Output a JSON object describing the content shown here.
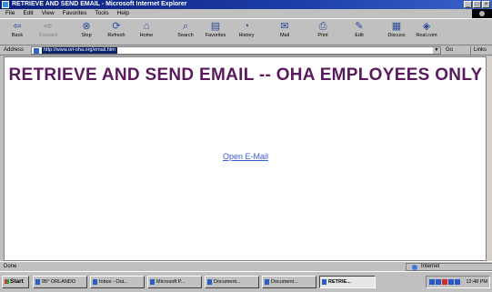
{
  "window": {
    "title": "RETRIEVE AND SEND EMAIL - Microsoft Internet Explorer",
    "controls": [
      "_",
      "□",
      "×"
    ]
  },
  "menu": [
    "File",
    "Edit",
    "View",
    "Favorites",
    "Tools",
    "Help"
  ],
  "toolbar": {
    "back": "Back",
    "forward": "Forward",
    "stop": "Stop",
    "refresh": "Refresh",
    "home": "Home",
    "search": "Search",
    "favorites": "Favorites",
    "history": "History",
    "mail": "Mail",
    "print": "Print",
    "edit": "Edit",
    "discuss": "Discuss",
    "realcom": "Real.com"
  },
  "address": {
    "label": "Address",
    "url": "http://www.orl-oha.org/email.htm",
    "go": "Go",
    "links": "Links"
  },
  "page": {
    "heading": "RETRIEVE AND SEND EMAIL -- OHA EMPLOYEES ONLY",
    "link": "Open E-Mail",
    "heading_color": "#5a1a5e",
    "link_color": "#3b5bd6"
  },
  "status": {
    "text": "Done",
    "zone": "Internet"
  },
  "taskbar": {
    "start": "Start",
    "tasks": [
      "95° ORLANDO",
      "Inbox - Out...",
      "Microsoft P...",
      "Document...",
      "Document...",
      "RETRIE..."
    ],
    "clock": "12:48 PM"
  }
}
